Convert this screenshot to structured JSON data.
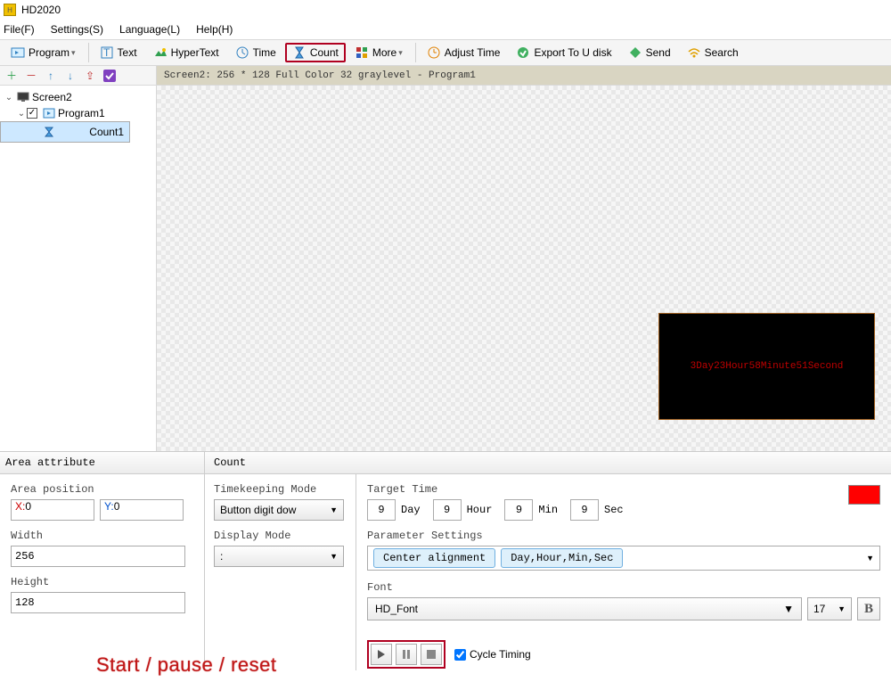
{
  "app": {
    "title": "HD2020"
  },
  "menu": {
    "file": "File(F)",
    "settings": "Settings(S)",
    "language": "Language(L)",
    "help": "Help(H)"
  },
  "toolbar": {
    "program": "Program",
    "text": "Text",
    "hypertext": "HyperText",
    "time": "Time",
    "count": "Count",
    "more": "More",
    "adjust": "Adjust Time",
    "export": "Export To U disk",
    "send": "Send",
    "search": "Search"
  },
  "breadcrumb": "Screen2: 256 * 128 Full Color 32 graylevel - Program1",
  "tree": {
    "screen": "Screen2",
    "program": "Program1",
    "count": "Count1"
  },
  "preview": "3Day23Hour58Minute51Second",
  "panel": {
    "area_attribute": "Area attribute",
    "count": "Count",
    "area_position": "Area position",
    "x_val": "0",
    "y_val": "0",
    "width_lbl": "Width",
    "width_val": "256",
    "height_lbl": "Height",
    "height_val": "128",
    "timekeeping_lbl": "Timekeeping Mode",
    "timekeeping_val": "Button digit dow",
    "display_lbl": "Display Mode",
    "display_val": ":",
    "target_lbl": "Target Time",
    "t_day_val": "9",
    "t_day_u": "Day",
    "t_hour_val": "9",
    "t_hour_u": "Hour",
    "t_min_val": "9",
    "t_min_u": "Min",
    "t_sec_val": "9",
    "t_sec_u": "Sec",
    "param_lbl": "Parameter Settings",
    "chip1": "Center alignment",
    "chip2": "Day,Hour,Min,Sec",
    "font_lbl": "Font",
    "font_val": "HD_Font",
    "size_val": "17",
    "annotation": "Start / pause / reset",
    "cycle": "Cycle Timing"
  }
}
